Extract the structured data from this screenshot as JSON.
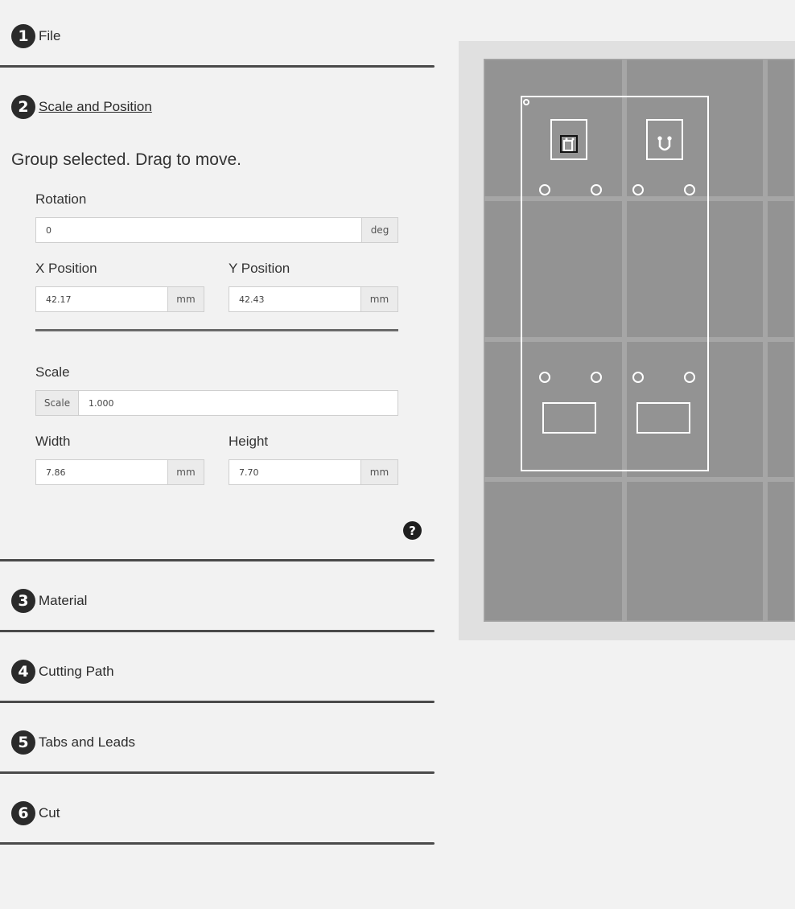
{
  "steps": [
    {
      "number": "1",
      "title": "File"
    },
    {
      "number": "2",
      "title": "Scale and Position"
    },
    {
      "number": "3",
      "title": "Material"
    },
    {
      "number": "4",
      "title": "Cutting Path"
    },
    {
      "number": "5",
      "title": "Tabs and Leads"
    },
    {
      "number": "6",
      "title": "Cut"
    }
  ],
  "scale_position": {
    "status_message": "Group selected. Drag to move.",
    "rotation": {
      "label": "Rotation",
      "value": "0",
      "unit": "deg"
    },
    "x_position": {
      "label": "X Position",
      "value": "42.17",
      "unit": "mm"
    },
    "y_position": {
      "label": "Y Position",
      "value": "42.43",
      "unit": "mm"
    },
    "scale": {
      "label": "Scale",
      "prefix": "Scale",
      "value": "1.000"
    },
    "width": {
      "label": "Width",
      "value": "7.86",
      "unit": "mm"
    },
    "height": {
      "label": "Height",
      "value": "7.70",
      "unit": "mm"
    },
    "help_icon": "question-circle-icon"
  },
  "canvas": {
    "bed_color": "#939393",
    "grid_color": "#a6a6a6",
    "outline_color": "#ffffff",
    "frame_color": "#e0e0e0"
  }
}
